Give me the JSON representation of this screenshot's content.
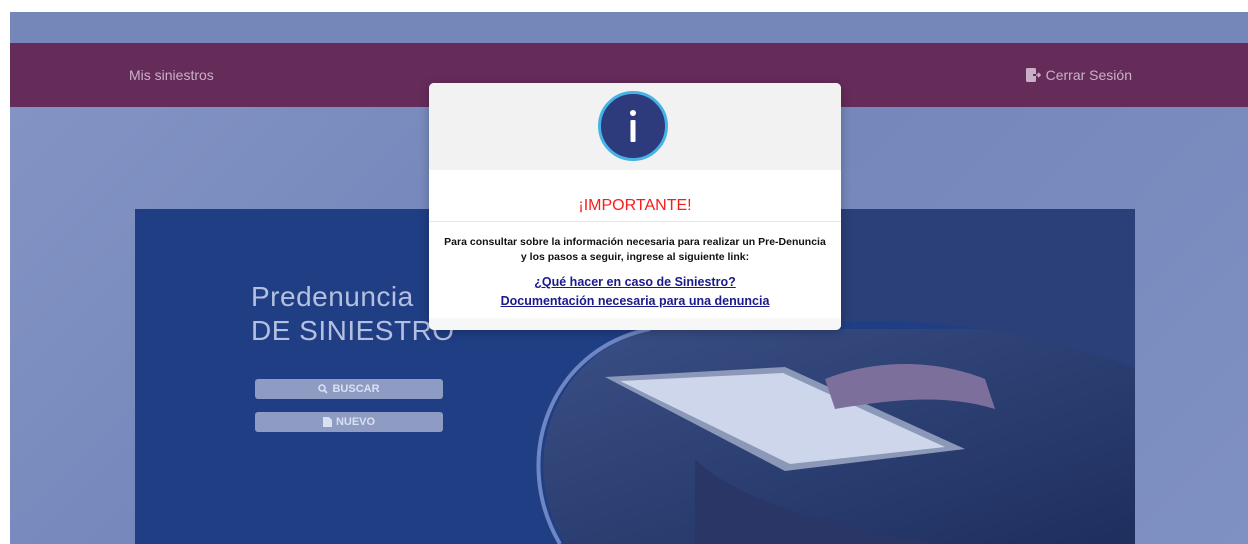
{
  "navbar": {
    "left_link": "Mis siniestros",
    "logout_label": "Cerrar Sesión",
    "logout_icon": "logout-icon"
  },
  "hero": {
    "title_line1": "Predenuncia",
    "title_line2": "DE SINIESTRO",
    "buttons": [
      {
        "label": "BUSCAR",
        "icon": "search-icon"
      },
      {
        "label": "NUEVO",
        "icon": "file-icon"
      }
    ]
  },
  "modal": {
    "icon": "info-icon",
    "icon_glyph": "i",
    "title": "¡IMPORTANTE!",
    "body": "Para consultar sobre la información necesaria para realizar un Pre-Denuncia y los pasos a seguir, ingrese al siguiente link:",
    "link1": "¿Qué hacer en caso de Siniestro?",
    "link2": "Documentación necesaria para una denuncia"
  },
  "colors": {
    "navbar": "#652c5a",
    "modal_title": "#ff1a1a",
    "info_circle": "#2d3a7c",
    "info_ring": "#45b3e6"
  }
}
